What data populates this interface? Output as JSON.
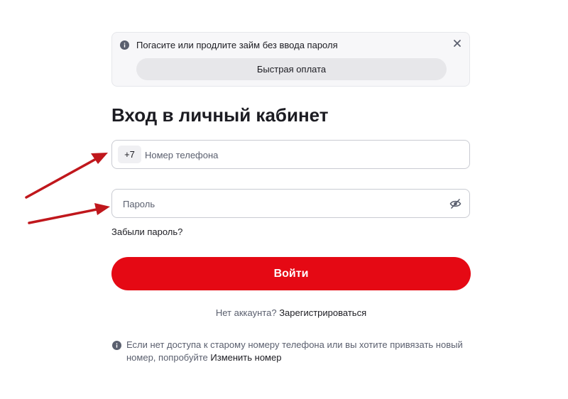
{
  "banner": {
    "text": "Погасите или продлите займ без ввода пароля",
    "quick_pay_label": "Быстрая оплата",
    "info_icon": "info-icon",
    "close_icon": "close-icon"
  },
  "title": "Вход в личный кабинет",
  "phone": {
    "country_code": "+7",
    "placeholder": "Номер телефона",
    "value": ""
  },
  "password": {
    "placeholder": "Пароль",
    "value": "",
    "toggle_icon": "eye-slash-icon"
  },
  "forgot_label": "Забыли пароль?",
  "login_label": "Войти",
  "register": {
    "prefix": "Нет аккаунта?",
    "link": "Зарегистрироваться"
  },
  "note": {
    "text": "Если нет доступа к старому номеру телефона или вы хотите привязать новый номер, попробуйте",
    "link": "Изменить номер",
    "icon": "info-icon"
  },
  "colors": {
    "accent": "#e50914",
    "annotation_arrow": "#c0171c",
    "text_primary": "#1c1c22",
    "text_secondary": "#5a5f6e",
    "border": "#c9cbd2",
    "banner_bg": "#f7f7f9"
  }
}
